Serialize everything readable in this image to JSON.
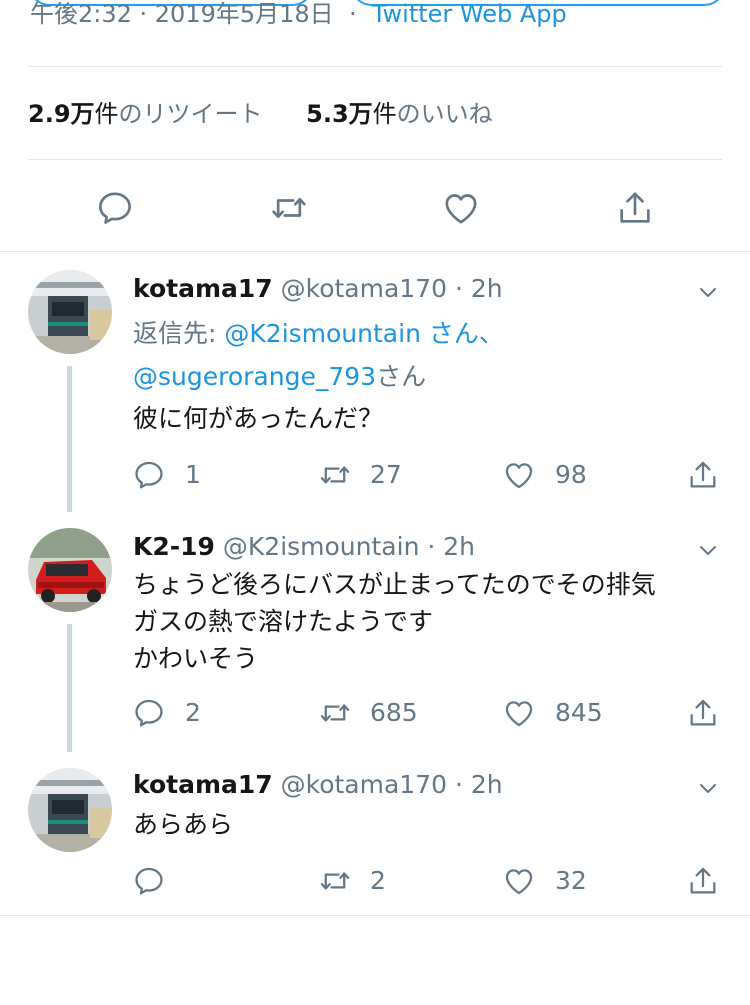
{
  "top": {
    "timestamp": "午後2:32 · 2019年5月18日",
    "app_name": "Twitter Web App"
  },
  "stats": {
    "retweets_count": "2.9万",
    "retweets_unit": "件",
    "retweets_label": "のリツイート",
    "likes_count": "5.3万",
    "likes_unit": "件",
    "likes_label": "のいいね"
  },
  "main_actions": [
    "reply-icon",
    "retweet-icon",
    "like-icon",
    "share-icon"
  ],
  "replies": [
    {
      "name": "kotama17",
      "handle": "@kotama170",
      "dot": "·",
      "time": "2h",
      "reply_to_label": "返信先:",
      "reply_to_user1": "@K2ismountain",
      "reply_to_sep": "さん、",
      "reply_to_user2": "@sugerorange_793",
      "reply_to_suffix": "さん",
      "text_lines": [
        "彼に何があったんだ？"
      ],
      "reply_count": "1",
      "retweet_count": "27",
      "like_count": "98"
    },
    {
      "name": "K2-19",
      "handle": "@K2ismountain",
      "dot": "·",
      "time": "2h",
      "text_lines": [
        "ちょうど後ろにバスが止まってたのでその排気",
        "ガスの熱で溶けたようです",
        "かわいそう"
      ],
      "reply_count": "2",
      "retweet_count": "685",
      "like_count": "845"
    },
    {
      "name": "kotama17",
      "handle": "@kotama170",
      "dot": "·",
      "time": "2h",
      "text_lines": [
        "あらあら"
      ],
      "reply_count": "",
      "retweet_count": "2",
      "like_count": "32"
    }
  ],
  "colors": {
    "accent": "#1da1f2",
    "link": "#1b95e0",
    "muted": "#657786",
    "divider": "#e1e8ed",
    "thread": "#ccd6dd"
  }
}
